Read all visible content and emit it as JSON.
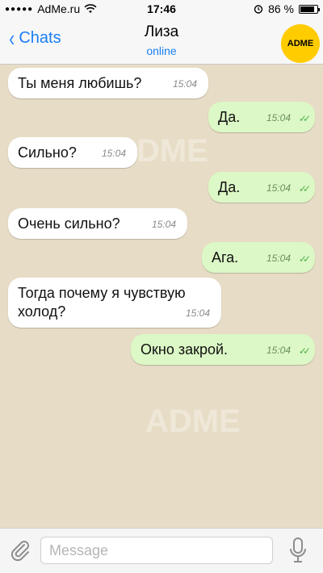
{
  "status": {
    "carrier": "AdMe.ru",
    "time": "17:46",
    "battery": "86 %",
    "battery_level": 0.86
  },
  "header": {
    "back_label": "Chats",
    "contact_name": "Лиза",
    "contact_status": "online",
    "avatar_text": "ADME"
  },
  "messages": [
    {
      "direction": "in",
      "text": "Ты меня любишь?",
      "time": "15:04"
    },
    {
      "direction": "out",
      "text": "Да.",
      "time": "15:04"
    },
    {
      "direction": "in",
      "text": "Сильно?",
      "time": "15:04"
    },
    {
      "direction": "out",
      "text": "Да.",
      "time": "15:04"
    },
    {
      "direction": "in",
      "text": "Очень сильно?",
      "time": "15:04"
    },
    {
      "direction": "out",
      "text": "Ага.",
      "time": "15:04"
    },
    {
      "direction": "in",
      "text": "Тогда почему я чувствую холод?",
      "time": "15:04"
    },
    {
      "direction": "out",
      "text": "Окно закрой.",
      "time": "15:04"
    }
  ],
  "composer": {
    "placeholder": "Message"
  },
  "colors": {
    "accent": "#1a7ef5",
    "outgoing_bubble": "#dcf8c6",
    "incoming_bubble": "#ffffff",
    "chat_background": "#e7dcc5",
    "avatar": "#ffcc00"
  }
}
